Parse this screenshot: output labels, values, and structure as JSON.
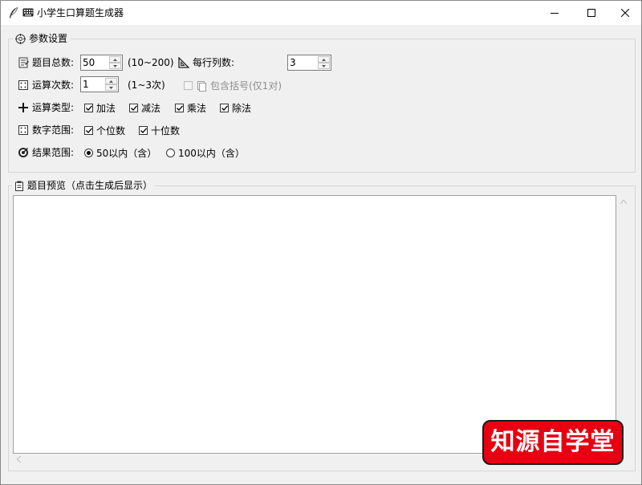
{
  "window": {
    "title": "小学生口算题生成器",
    "title_emoji": "keyboard-icon",
    "controls": {
      "minimize": "minimize",
      "maximize": "maximize",
      "close": "close"
    }
  },
  "params_group": {
    "legend_icon": "target-icon",
    "legend": "参数设置",
    "total_questions": {
      "label": "题目总数:",
      "icon": "memo-icon",
      "value": "50",
      "hint": "(10~200)"
    },
    "per_row": {
      "label": "每行列数:",
      "icon": "triangle-ruler-icon",
      "value": "3"
    },
    "op_count": {
      "label": "运算次数:",
      "icon": "dice-icon",
      "value": "1",
      "hint": "(1~3次)"
    },
    "parentheses": {
      "label": "包含括号(仅1对)",
      "icon": "pages-icon",
      "checked": false,
      "disabled": true
    },
    "op_types": {
      "label": "运算类型:",
      "icon": "plus-icon",
      "options": [
        {
          "label": "加法",
          "checked": true
        },
        {
          "label": "减法",
          "checked": true
        },
        {
          "label": "乘法",
          "checked": true
        },
        {
          "label": "除法",
          "checked": true
        }
      ]
    },
    "number_range": {
      "label": "数字范围:",
      "icon": "dice-icon",
      "options": [
        {
          "label": "个位数",
          "checked": true
        },
        {
          "label": "十位数",
          "checked": true
        }
      ]
    },
    "result_range": {
      "label": "结果范围:",
      "icon": "bullseye-icon",
      "options": [
        {
          "label": "50以内（含）",
          "selected": true
        },
        {
          "label": "100以内（含）",
          "selected": false
        }
      ]
    }
  },
  "preview_group": {
    "legend_icon": "clipboard-icon",
    "legend": "题目预览（点击生成后显示）",
    "content": ""
  },
  "watermark": {
    "text": "知源自学堂",
    "bg_color": "#e60012"
  }
}
